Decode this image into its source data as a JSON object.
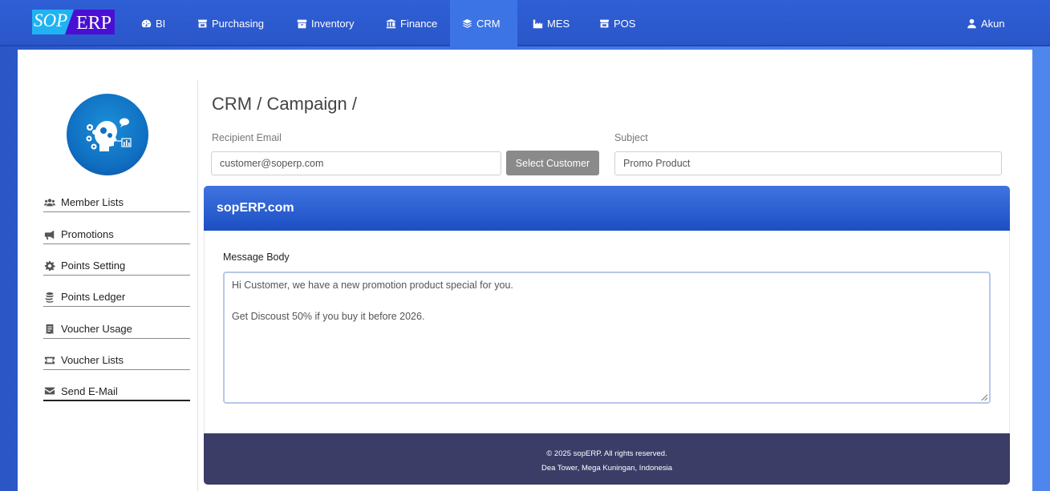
{
  "brand": {
    "sop": "SOP",
    "erp": "ERP"
  },
  "nav": {
    "items": [
      {
        "label": "BI",
        "icon": "dashboard-icon"
      },
      {
        "label": "Purchasing",
        "icon": "store-icon"
      },
      {
        "label": "Inventory",
        "icon": "box-icon"
      },
      {
        "label": "Finance",
        "icon": "bank-icon"
      },
      {
        "label": "CRM",
        "icon": "layers-icon",
        "active": true
      },
      {
        "label": "MES",
        "icon": "industry-icon"
      },
      {
        "label": "POS",
        "icon": "store-icon"
      }
    ],
    "account": "Akun"
  },
  "sidebar": {
    "items": [
      {
        "label": "Member Lists",
        "icon": "users-icon"
      },
      {
        "label": "Promotions",
        "icon": "megaphone-icon"
      },
      {
        "label": "Points Setting",
        "icon": "gear-icon"
      },
      {
        "label": "Points Ledger",
        "icon": "coins-icon"
      },
      {
        "label": "Voucher Usage",
        "icon": "receipt-icon"
      },
      {
        "label": "Voucher Lists",
        "icon": "ticket-icon"
      },
      {
        "label": "Send E-Mail",
        "icon": "envelope-icon",
        "active": true
      }
    ]
  },
  "page": {
    "title": "CRM / Campaign /",
    "recipient_label": "Recipient Email",
    "recipient_value": "customer@soperp.com",
    "select_customer": "Select Customer",
    "subject_label": "Subject",
    "subject_value": "Promo Product"
  },
  "email": {
    "header": "sopERP.com",
    "body_label": "Message Body",
    "body_line1": "Hi Customer, we have a new promotion product special for you.",
    "body_line2": "",
    "body_line3": "Get Discoust 50% if you buy it before 2026."
  },
  "footer": {
    "copyright": "© 2025 sopERP. All rights reserved.",
    "address": "Dea Tower, Mega Kuningan, Indonesia"
  }
}
